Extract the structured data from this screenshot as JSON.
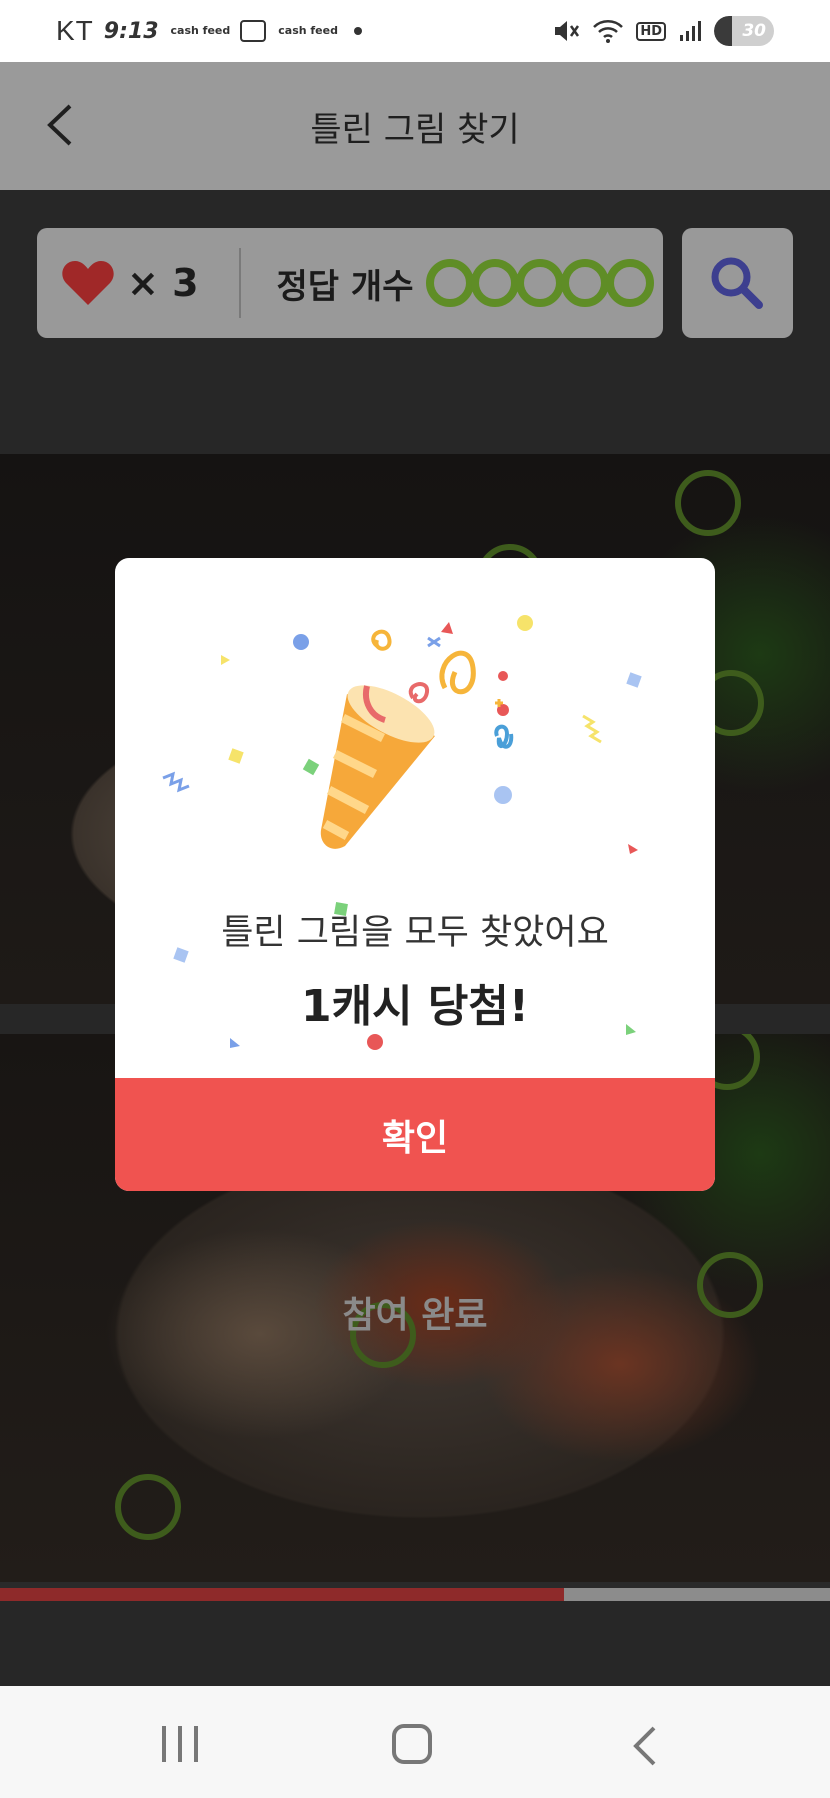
{
  "status_bar": {
    "carrier": "KT",
    "time": "9:13",
    "app_badge_1": "cash feed",
    "app_badge_2": "cash feed",
    "hd": "HD",
    "battery": "30",
    "battery_level": 0.3
  },
  "header": {
    "title": "틀린 그림 찾기",
    "back_icon": "chevron-left-icon"
  },
  "score": {
    "lives_text": "× 3",
    "answer_label": "정답 개수",
    "answers_found": 5,
    "answers_total": 5,
    "search_icon": "search-icon",
    "ring_color": "#5f8d26"
  },
  "game": {
    "status_label": "참여 완료",
    "progress": 0.68
  },
  "modal": {
    "message": "틀린 그림을 모두 찾았어요",
    "prize": "1캐시 당첨!",
    "confirm_label": "확인",
    "confirm_color": "#f05350",
    "illustration": "party-popper-icon"
  },
  "nav": {
    "recent": "recent-apps-icon",
    "home": "home-icon",
    "back": "back-icon"
  }
}
